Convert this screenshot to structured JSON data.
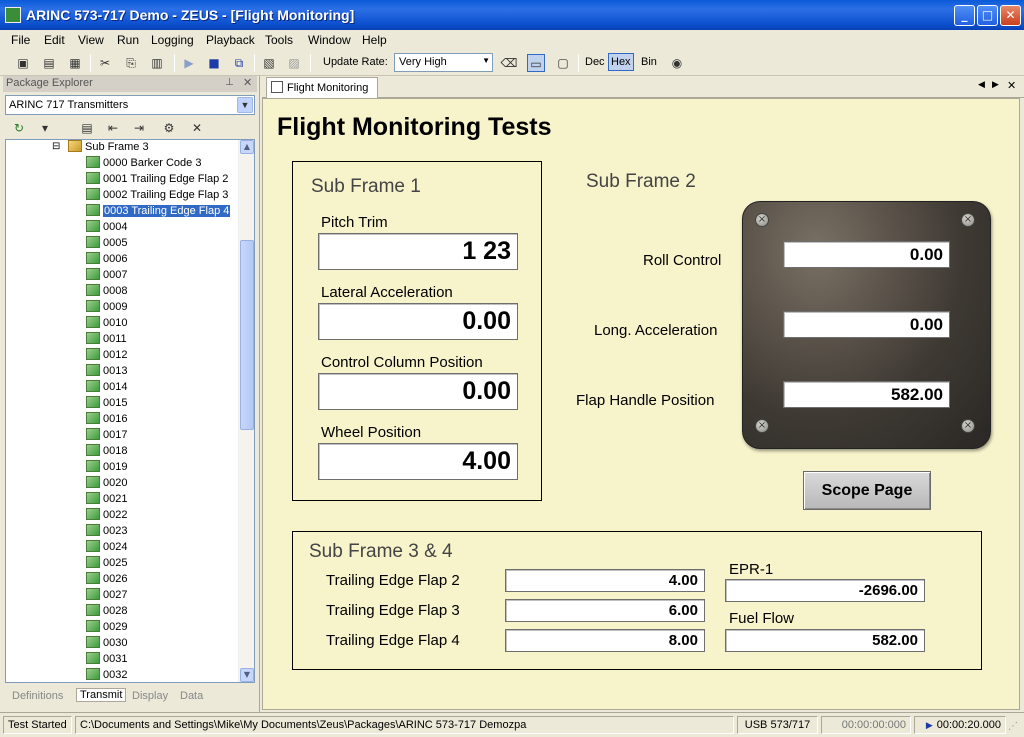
{
  "window": {
    "title": "ARINC 573-717 Demo - ZEUS - [Flight Monitoring]"
  },
  "menu": [
    "File",
    "Edit",
    "View",
    "Run",
    "Logging",
    "Playback",
    "Tools",
    "Window",
    "Help"
  ],
  "toolbar": {
    "update_rate_label": "Update Rate:",
    "update_rate_value": "Very High",
    "dec": "Dec",
    "hex": "Hex",
    "bin": "Bin"
  },
  "explorer": {
    "header": "Package Explorer",
    "combo": "ARINC 717 Transmitters",
    "parent": "Sub Frame 3",
    "items": [
      "0000 Barker Code 3",
      "0001 Trailing Edge Flap 2",
      "0002 Trailing Edge Flap 3",
      "0003 Trailing Edge Flap 4",
      "0004",
      "0005",
      "0006",
      "0007",
      "0008",
      "0009",
      "0010",
      "0011",
      "0012",
      "0013",
      "0014",
      "0015",
      "0016",
      "0017",
      "0018",
      "0019",
      "0020",
      "0021",
      "0022",
      "0023",
      "0024",
      "0025",
      "0026",
      "0027",
      "0028",
      "0029",
      "0030",
      "0031",
      "0032"
    ],
    "selected_index": 3,
    "tabs": [
      "Definitions",
      "Transmit",
      "Display",
      "Data"
    ]
  },
  "doc_tab": "Flight Monitoring",
  "page": {
    "title": "Flight Monitoring Tests",
    "sf1": {
      "title": "Sub Frame 1",
      "fields": [
        {
          "label": "Pitch Trim",
          "value": "1 23"
        },
        {
          "label": "Lateral Acceleration",
          "value": "0.00"
        },
        {
          "label": "Control Column Position",
          "value": "0.00"
        },
        {
          "label": "Wheel Position",
          "value": "4.00"
        }
      ]
    },
    "sf2": {
      "title": "Sub Frame 2",
      "fields": [
        {
          "label": "Roll Control",
          "value": "0.00"
        },
        {
          "label": "Long. Acceleration",
          "value": "0.00"
        },
        {
          "label": "Flap Handle Position",
          "value": "582.00"
        }
      ]
    },
    "scope_button": "Scope Page",
    "sf34": {
      "title": "Sub Frame 3 & 4",
      "fields": [
        {
          "label": "Trailing Edge Flap 2",
          "value": "4.00"
        },
        {
          "label": "Trailing Edge Flap 3",
          "value": "6.00"
        },
        {
          "label": "Trailing Edge Flap 4",
          "value": "8.00"
        }
      ],
      "epr_label": "EPR-1",
      "epr_value": "-2696.00",
      "fuel_label": "Fuel Flow",
      "fuel_value": "582.00"
    }
  },
  "status": {
    "state": "Test Started",
    "path": "C:\\Documents and Settings\\Mike\\My Documents\\Zeus\\Packages\\ARINC 573-717 Demozpa",
    "device": "USB 573/717",
    "time1": "00:00:00:000",
    "time2": "00:00:20.000"
  }
}
